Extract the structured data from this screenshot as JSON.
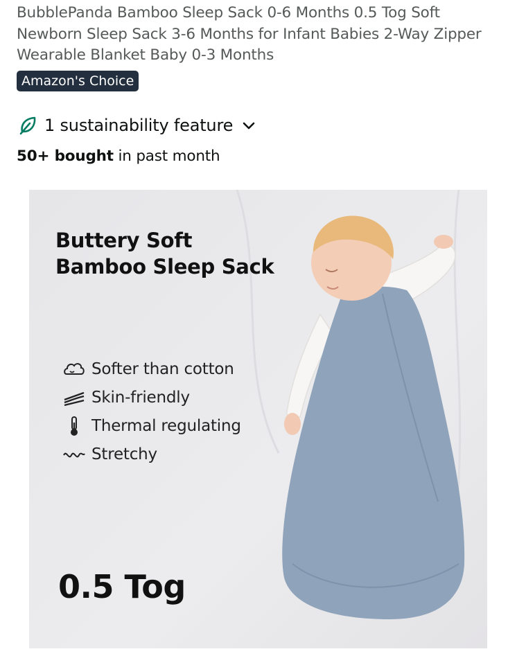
{
  "product": {
    "title": "BubblePanda Bamboo Sleep Sack 0-6 Months 0.5 Tog Soft Newborn Sleep Sack 3-6 Months for Infant Babies 2-Way Zipper Wearable Blanket Baby 0-3 Months",
    "badge": "Amazon's Choice",
    "sustainability": {
      "icon": "leaf-icon",
      "label": "1 sustainability feature",
      "accent": "#067d62"
    },
    "bought": {
      "bold": "50+ bought",
      "rest": " in past month"
    }
  },
  "hero_image": {
    "headline_line1": "Buttery Soft",
    "headline_line2": "Bamboo Sleep Sack",
    "features": [
      {
        "icon": "cloud-icon",
        "label": "Softer than cotton"
      },
      {
        "icon": "skin-icon",
        "label": "Skin-friendly"
      },
      {
        "icon": "thermometer-icon",
        "label": "Thermal regulating"
      },
      {
        "icon": "stretch-icon",
        "label": "Stretchy"
      }
    ],
    "tog_label": "0.5 Tog",
    "sack_color": "#8fa3bb"
  }
}
